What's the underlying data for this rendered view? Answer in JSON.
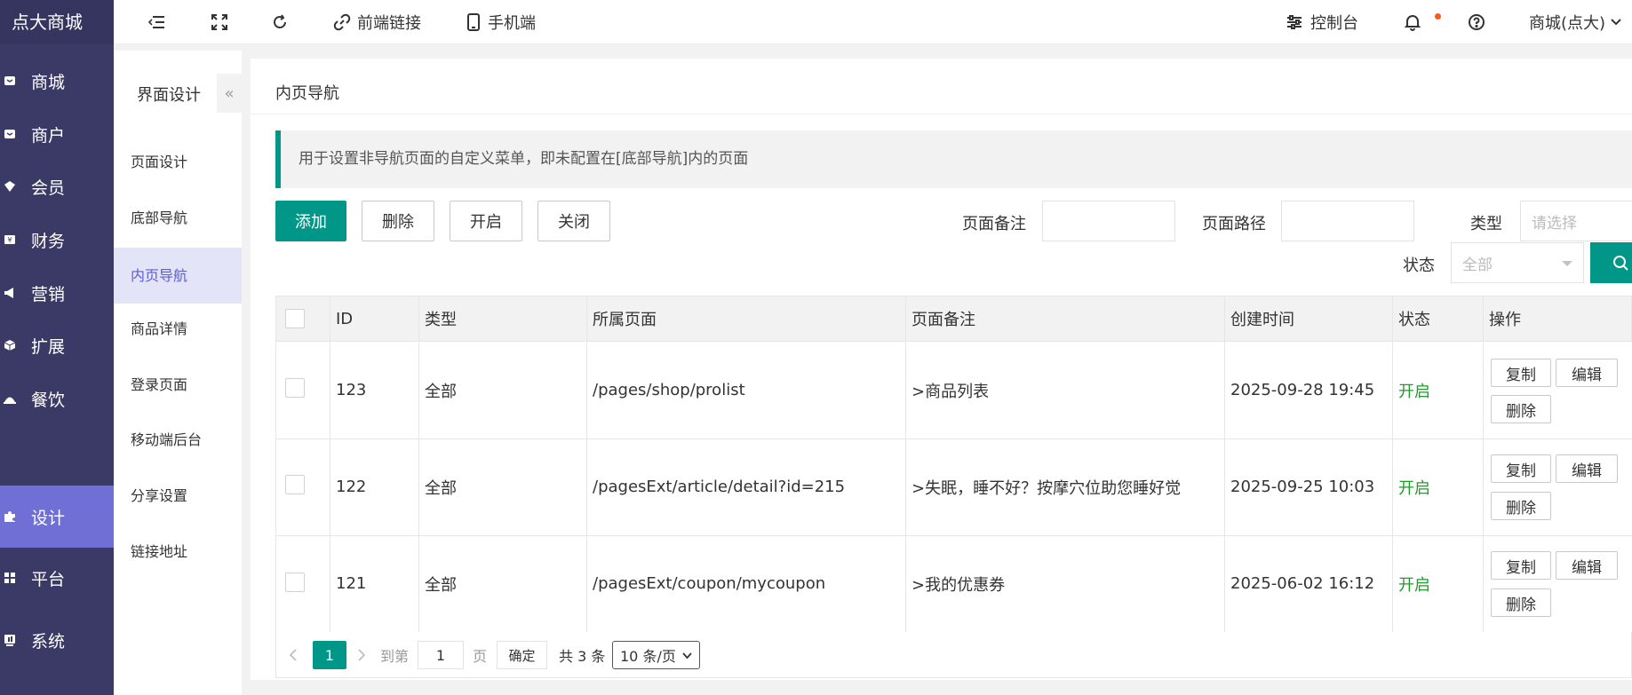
{
  "app": {
    "title": "点大商城"
  },
  "sidebar": {
    "items": [
      {
        "label": "商城",
        "icon": "store-icon"
      },
      {
        "label": "商户",
        "icon": "merchant-icon"
      },
      {
        "label": "会员",
        "icon": "member-icon"
      },
      {
        "label": "财务",
        "icon": "finance-icon"
      },
      {
        "label": "营销",
        "icon": "megaphone-icon"
      },
      {
        "label": "扩展",
        "icon": "cube-icon"
      },
      {
        "label": "餐饮",
        "icon": "dining-icon"
      },
      {
        "label": "设计",
        "icon": "puzzle-icon",
        "active": true
      },
      {
        "label": "平台",
        "icon": "grid-icon"
      },
      {
        "label": "系统",
        "icon": "system-icon"
      }
    ]
  },
  "header": {
    "frontend_link": "前端链接",
    "mobile": "手机端",
    "console": "控制台",
    "store_name": "商城(点大)"
  },
  "submenu": {
    "title": "界面设计",
    "collapse_glyph": "«",
    "items": [
      {
        "label": "页面设计"
      },
      {
        "label": "底部导航"
      },
      {
        "label": "内页导航",
        "active": true
      },
      {
        "label": "商品详情"
      },
      {
        "label": "登录页面"
      },
      {
        "label": "移动端后台"
      },
      {
        "label": "分享设置"
      },
      {
        "label": "链接地址"
      }
    ]
  },
  "main": {
    "title": "内页导航",
    "tip": "用于设置非导航页面的自定义菜单，即未配置在[底部导航]内的页面",
    "buttons": {
      "add": "添加",
      "delete": "删除",
      "enable": "开启",
      "disable": "关闭"
    },
    "filters": {
      "remark_label": "页面备注",
      "path_label": "页面路径",
      "type_label": "类型",
      "type_placeholder": "请选择",
      "status_label": "状态",
      "status_value": "全部"
    },
    "table": {
      "headers": [
        "ID",
        "类型",
        "所属页面",
        "页面备注",
        "创建时间",
        "状态",
        "操作"
      ],
      "rows": [
        {
          "id": "123",
          "type": "全部",
          "page": "/pages/shop/prolist",
          "remark": ">商品列表",
          "created": "2025-09-28 19:45",
          "status": "开启"
        },
        {
          "id": "122",
          "type": "全部",
          "page": "/pagesExt/article/detail?id=215",
          "remark": ">失眠，睡不好？按摩穴位助您睡好觉",
          "created": "2025-09-25 10:03",
          "status": "开启"
        },
        {
          "id": "121",
          "type": "全部",
          "page": "/pagesExt/coupon/mycoupon",
          "remark": ">我的优惠券",
          "created": "2025-06-02 16:12",
          "status": "开启"
        }
      ],
      "actions": {
        "copy": "复制",
        "edit": "编辑",
        "delete": "删除"
      }
    },
    "pagination": {
      "current_page": "1",
      "goto_label": "到第",
      "goto_value": "1",
      "page_unit": "页",
      "confirm": "确定",
      "total": "共 3 条",
      "page_size": "10 条/页"
    }
  },
  "colors": {
    "sidebar": "#3b3a66",
    "active": "#6f6fd6",
    "primary": "#009688",
    "status_on": "#1e9d29",
    "notify": "#ff5722"
  }
}
